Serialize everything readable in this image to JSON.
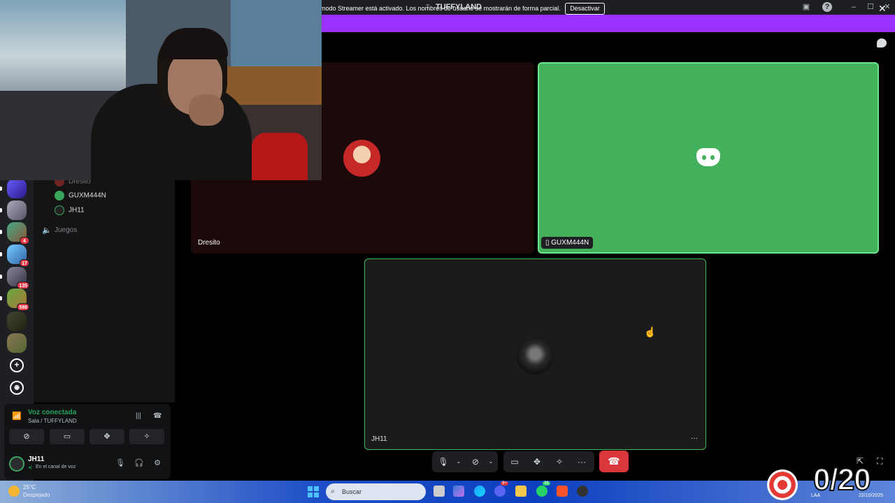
{
  "window": {
    "title": "TUFFYLAND",
    "title_prefix": "T"
  },
  "banner": {
    "text": "modo Streamer está activado. Los nombres de usuario se mostrarán de forma parcial.",
    "button_label": "Desactivar",
    "color": "#9b30ff"
  },
  "rail": {
    "badges": [
      "4",
      "17",
      "135",
      "598"
    ]
  },
  "channels": {
    "voice_users": [
      {
        "name": "Dresito"
      },
      {
        "name": "GUXM444N"
      },
      {
        "name": "JH11"
      }
    ],
    "other_channel": "Juegos"
  },
  "voice_panel": {
    "status": "Voz conectada",
    "channel": "Sala / TUFFYLAND",
    "user": "JH11",
    "user_status": "En el canal de voz"
  },
  "stage": {
    "tiles": [
      {
        "label": "Dresito"
      },
      {
        "label": "GUXM444N"
      },
      {
        "label": "JH11"
      }
    ]
  },
  "taskbar": {
    "weather_temp": "25°C",
    "weather_desc": "Despejado",
    "search": "Buscar",
    "lang": "LAA",
    "date": "22/10/2025",
    "badge_discord": "9+",
    "badge_whatsapp": "38"
  },
  "overlay": {
    "counter": "0/20"
  },
  "colors": {
    "speaking_green": "#43b05c",
    "hangup_red": "#da373c",
    "accent_purple": "#9b30ff"
  }
}
